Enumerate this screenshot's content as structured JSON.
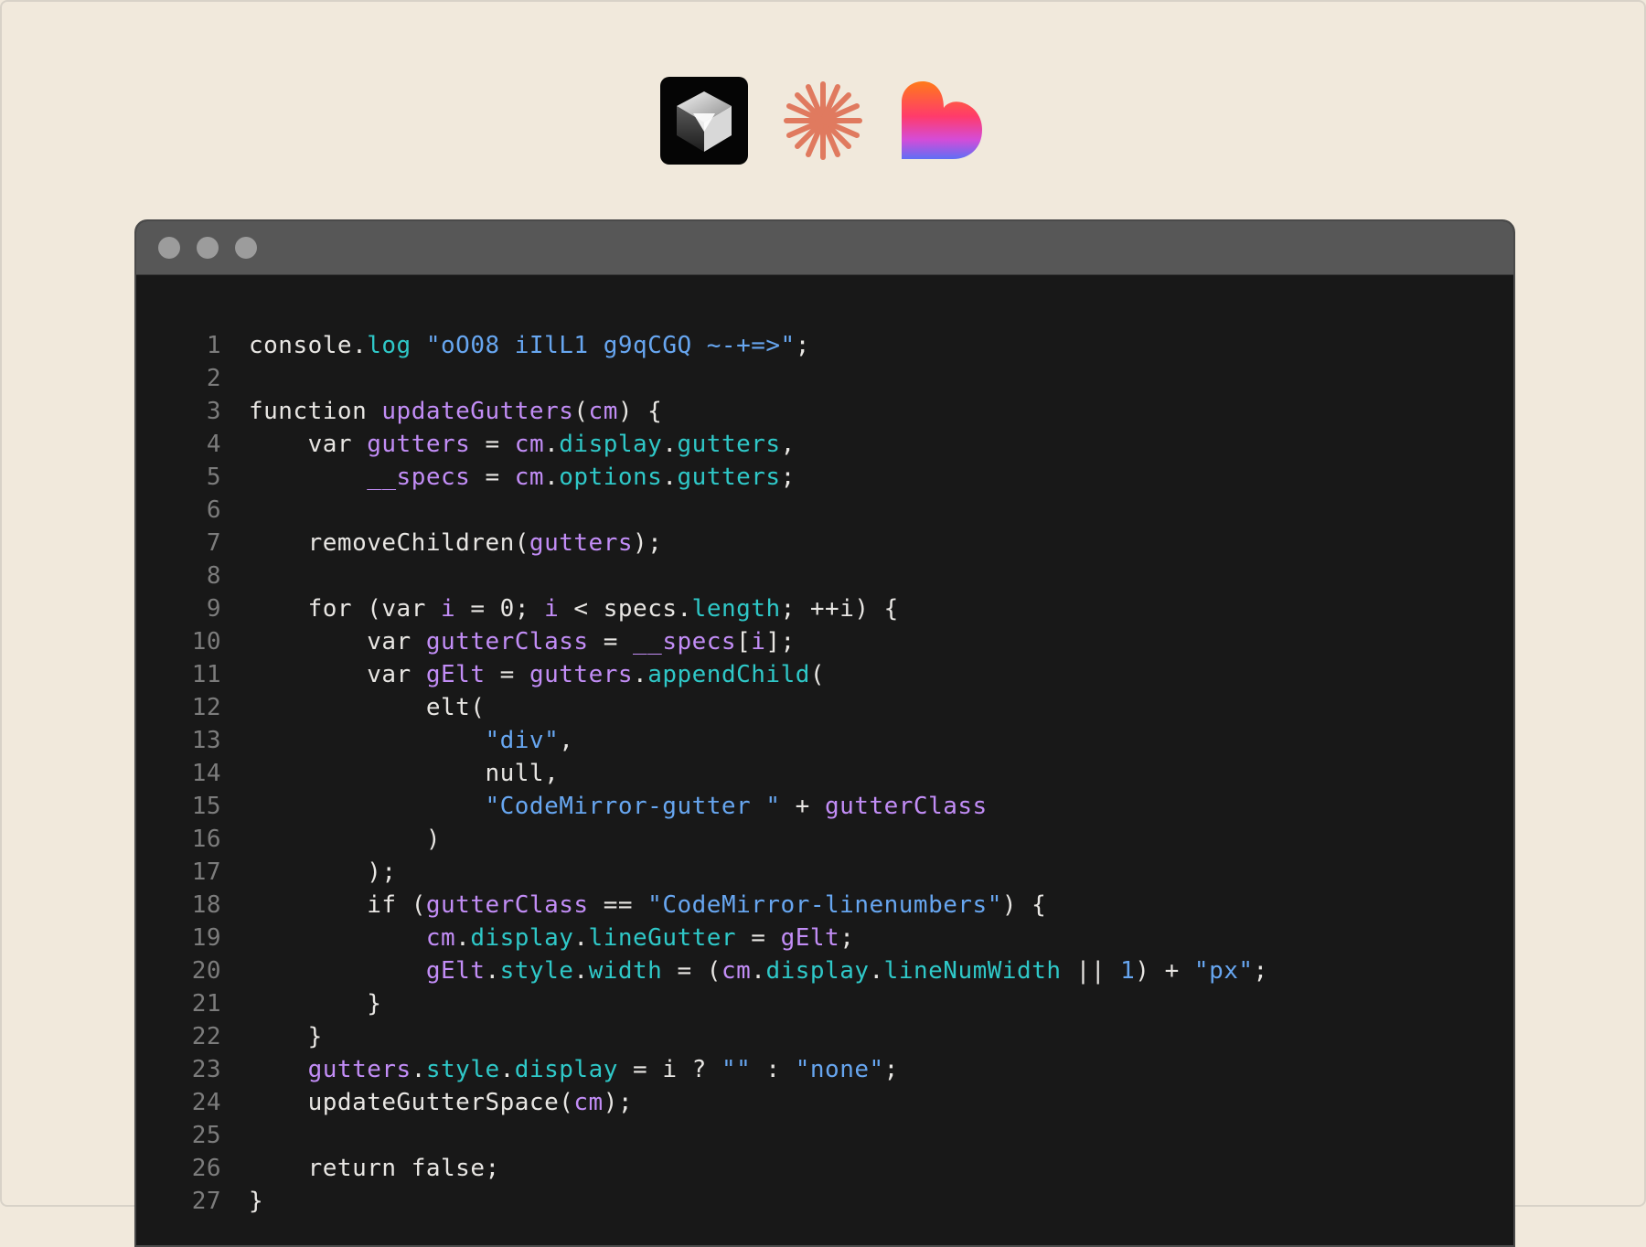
{
  "window": {
    "title_buttons": [
      "close",
      "minimize",
      "zoom"
    ]
  },
  "logos": [
    "cube-logo-icon",
    "sparkle-logo-icon",
    "heart-logo-icon"
  ],
  "colors": {
    "background": "#f1e9dc",
    "editor_bg": "#181818",
    "titlebar": "#575757",
    "keyword": "#e8e6e3",
    "function": "#c28df6",
    "property": "#2fc8c8",
    "string": "#67a6f0",
    "line_number": "#7c7c7c"
  },
  "code": {
    "language": "javascript",
    "lines": [
      {
        "n": "1",
        "tokens": [
          [
            "plain",
            "console."
          ],
          [
            "prop",
            "log"
          ],
          [
            "plain",
            " "
          ],
          [
            "str",
            "\"oO08 iIlL1 g9qCGQ ~-+=>\""
          ],
          [
            "plain",
            ";"
          ]
        ]
      },
      {
        "n": "2",
        "tokens": []
      },
      {
        "n": "3",
        "tokens": [
          [
            "kw",
            "function "
          ],
          [
            "fn",
            "updateGutters"
          ],
          [
            "plain",
            "("
          ],
          [
            "var",
            "cm"
          ],
          [
            "plain",
            ") {"
          ]
        ]
      },
      {
        "n": "4",
        "tokens": [
          [
            "plain",
            "    "
          ],
          [
            "kw",
            "var "
          ],
          [
            "var",
            "gutters"
          ],
          [
            "plain",
            " = "
          ],
          [
            "var",
            "cm"
          ],
          [
            "plain",
            "."
          ],
          [
            "prop",
            "display"
          ],
          [
            "plain",
            "."
          ],
          [
            "prop",
            "gutters"
          ],
          [
            "plain",
            ","
          ]
        ]
      },
      {
        "n": "5",
        "tokens": [
          [
            "plain",
            "        "
          ],
          [
            "var",
            "__specs"
          ],
          [
            "plain",
            " = "
          ],
          [
            "var",
            "cm"
          ],
          [
            "plain",
            "."
          ],
          [
            "prop",
            "options"
          ],
          [
            "plain",
            "."
          ],
          [
            "prop",
            "gutters"
          ],
          [
            "plain",
            ";"
          ]
        ]
      },
      {
        "n": "6",
        "tokens": []
      },
      {
        "n": "7",
        "tokens": [
          [
            "plain",
            "    removeChildren("
          ],
          [
            "var",
            "gutters"
          ],
          [
            "plain",
            ");"
          ]
        ]
      },
      {
        "n": "8",
        "tokens": []
      },
      {
        "n": "9",
        "tokens": [
          [
            "plain",
            "    "
          ],
          [
            "kw",
            "for "
          ],
          [
            "plain",
            "("
          ],
          [
            "kw",
            "var "
          ],
          [
            "var",
            "i"
          ],
          [
            "plain",
            " = "
          ],
          [
            "plain",
            "0"
          ],
          [
            "plain",
            "; "
          ],
          [
            "var",
            "i"
          ],
          [
            "plain",
            " < specs."
          ],
          [
            "prop",
            "length"
          ],
          [
            "plain",
            "; ++i) {"
          ]
        ]
      },
      {
        "n": "10",
        "tokens": [
          [
            "plain",
            "        "
          ],
          [
            "kw",
            "var "
          ],
          [
            "var",
            "gutterClass"
          ],
          [
            "plain",
            " = "
          ],
          [
            "var",
            "__specs"
          ],
          [
            "plain",
            "["
          ],
          [
            "var",
            "i"
          ],
          [
            "plain",
            "];"
          ]
        ]
      },
      {
        "n": "11",
        "tokens": [
          [
            "plain",
            "        "
          ],
          [
            "kw",
            "var "
          ],
          [
            "var",
            "gElt"
          ],
          [
            "plain",
            " = "
          ],
          [
            "var",
            "gutters"
          ],
          [
            "plain",
            "."
          ],
          [
            "prop",
            "appendChild"
          ],
          [
            "plain",
            "("
          ]
        ]
      },
      {
        "n": "12",
        "tokens": [
          [
            "plain",
            "            elt("
          ]
        ]
      },
      {
        "n": "13",
        "tokens": [
          [
            "plain",
            "                "
          ],
          [
            "str",
            "\"div\""
          ],
          [
            "plain",
            ","
          ]
        ]
      },
      {
        "n": "14",
        "tokens": [
          [
            "plain",
            "                null,"
          ]
        ]
      },
      {
        "n": "15",
        "tokens": [
          [
            "plain",
            "                "
          ],
          [
            "str",
            "\"CodeMirror-gutter \""
          ],
          [
            "plain",
            " + "
          ],
          [
            "var",
            "gutterClass"
          ]
        ]
      },
      {
        "n": "16",
        "tokens": [
          [
            "plain",
            "            )"
          ]
        ]
      },
      {
        "n": "17",
        "tokens": [
          [
            "plain",
            "        );"
          ]
        ]
      },
      {
        "n": "18",
        "tokens": [
          [
            "plain",
            "        "
          ],
          [
            "kw",
            "if "
          ],
          [
            "plain",
            "("
          ],
          [
            "var",
            "gutterClass"
          ],
          [
            "plain",
            " == "
          ],
          [
            "str",
            "\"CodeMirror-linenumbers\""
          ],
          [
            "plain",
            ") {"
          ]
        ]
      },
      {
        "n": "19",
        "tokens": [
          [
            "plain",
            "            "
          ],
          [
            "var",
            "cm"
          ],
          [
            "plain",
            "."
          ],
          [
            "prop",
            "display"
          ],
          [
            "plain",
            "."
          ],
          [
            "prop",
            "lineGutter"
          ],
          [
            "plain",
            " = "
          ],
          [
            "var",
            "gElt"
          ],
          [
            "plain",
            ";"
          ]
        ]
      },
      {
        "n": "20",
        "tokens": [
          [
            "plain",
            "            "
          ],
          [
            "var",
            "gElt"
          ],
          [
            "plain",
            "."
          ],
          [
            "prop",
            "style"
          ],
          [
            "plain",
            "."
          ],
          [
            "prop",
            "width"
          ],
          [
            "plain",
            " = ("
          ],
          [
            "var",
            "cm"
          ],
          [
            "plain",
            "."
          ],
          [
            "prop",
            "display"
          ],
          [
            "plain",
            "."
          ],
          [
            "prop",
            "lineNumWidth"
          ],
          [
            "plain",
            " || "
          ],
          [
            "num",
            "1"
          ],
          [
            "plain",
            ") + "
          ],
          [
            "str",
            "\"px\""
          ],
          [
            "plain",
            ";"
          ]
        ]
      },
      {
        "n": "21",
        "tokens": [
          [
            "plain",
            "        }"
          ]
        ]
      },
      {
        "n": "22",
        "tokens": [
          [
            "plain",
            "    }"
          ]
        ]
      },
      {
        "n": "23",
        "tokens": [
          [
            "plain",
            "    "
          ],
          [
            "var",
            "gutters"
          ],
          [
            "plain",
            "."
          ],
          [
            "prop",
            "style"
          ],
          [
            "plain",
            "."
          ],
          [
            "prop",
            "display"
          ],
          [
            "plain",
            " = i ? "
          ],
          [
            "str",
            "\"\""
          ],
          [
            "plain",
            " : "
          ],
          [
            "str",
            "\"none\""
          ],
          [
            "plain",
            ";"
          ]
        ]
      },
      {
        "n": "24",
        "tokens": [
          [
            "plain",
            "    updateGutterSpace("
          ],
          [
            "var",
            "cm"
          ],
          [
            "plain",
            ");"
          ]
        ]
      },
      {
        "n": "25",
        "tokens": []
      },
      {
        "n": "26",
        "tokens": [
          [
            "plain",
            "    "
          ],
          [
            "kw",
            "return "
          ],
          [
            "plain",
            "false;"
          ]
        ]
      },
      {
        "n": "27",
        "tokens": [
          [
            "plain",
            "}"
          ]
        ]
      }
    ]
  }
}
